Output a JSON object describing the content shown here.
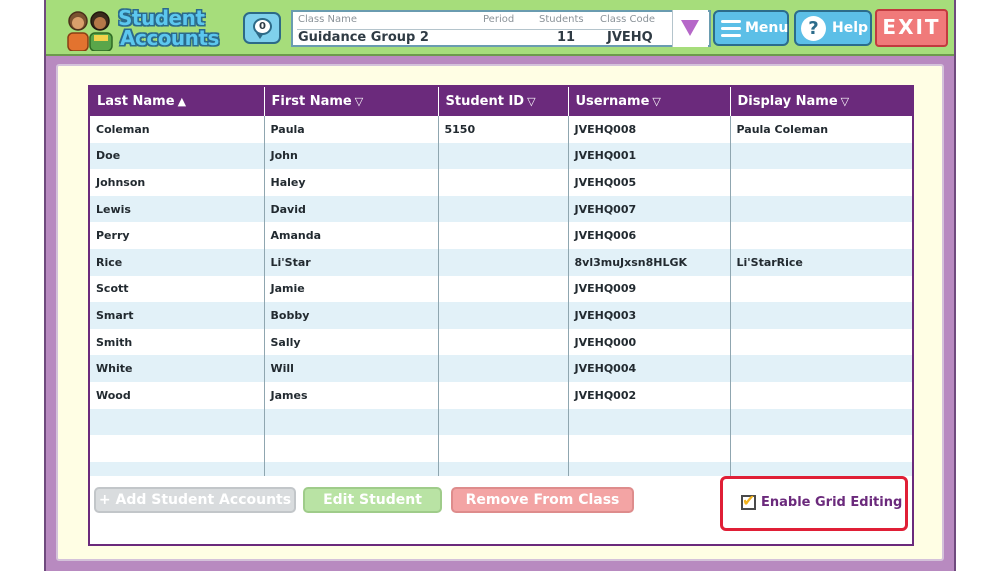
{
  "app": {
    "logo_line1": "Student",
    "logo_line2": "Accounts"
  },
  "messages": {
    "count": "0"
  },
  "class_info": {
    "name_label": "Class Name",
    "name_value": "Guidance Group 2",
    "period_label": "Period",
    "period_value": "",
    "students_label": "Students",
    "students_value": "11",
    "code_label": "Class Code",
    "code_value": "JVEHQ"
  },
  "nav": {
    "menu_label": "Menu",
    "help_label": "Help",
    "exit_label": "EXIT"
  },
  "table": {
    "columns": [
      {
        "label": "Last Name",
        "sort": "▲"
      },
      {
        "label": "First Name",
        "sort": "▽"
      },
      {
        "label": "Student ID",
        "sort": "▽"
      },
      {
        "label": "Username",
        "sort": "▽"
      },
      {
        "label": "Display Name",
        "sort": "▽"
      }
    ],
    "rows": [
      [
        "Coleman",
        "Paula",
        "5150",
        "JVEHQ008",
        "Paula Coleman"
      ],
      [
        "Doe",
        "John",
        "",
        "JVEHQ001",
        ""
      ],
      [
        "Johnson",
        "Haley",
        "",
        "JVEHQ005",
        ""
      ],
      [
        "Lewis",
        "David",
        "",
        "JVEHQ007",
        ""
      ],
      [
        "Perry",
        "Amanda",
        "",
        "JVEHQ006",
        ""
      ],
      [
        "Rice",
        "Li'Star",
        "",
        "8vl3muJxsn8HLGK",
        "Li'StarRice"
      ],
      [
        "Scott",
        "Jamie",
        "",
        "JVEHQ009",
        ""
      ],
      [
        "Smart",
        "Bobby",
        "",
        "JVEHQ003",
        ""
      ],
      [
        "Smith",
        "Sally",
        "",
        "JVEHQ000",
        ""
      ],
      [
        "White",
        "Will",
        "",
        "JVEHQ004",
        ""
      ],
      [
        "Wood",
        "James",
        "",
        "JVEHQ002",
        ""
      ]
    ],
    "empty_rows": 3
  },
  "actions": {
    "add_label": "+ Add Student Accounts",
    "edit_label": "Edit Student",
    "remove_label": "Remove From Class",
    "enable_grid_label": "Enable Grid Editing",
    "enable_grid_checked": true
  },
  "colors": {
    "header_bg": "#a6dd7b",
    "frame_bg": "#b88ac0",
    "table_header": "#6b2a7c",
    "row_alt": "#e2f1f8",
    "highlight": "#e01f36"
  }
}
